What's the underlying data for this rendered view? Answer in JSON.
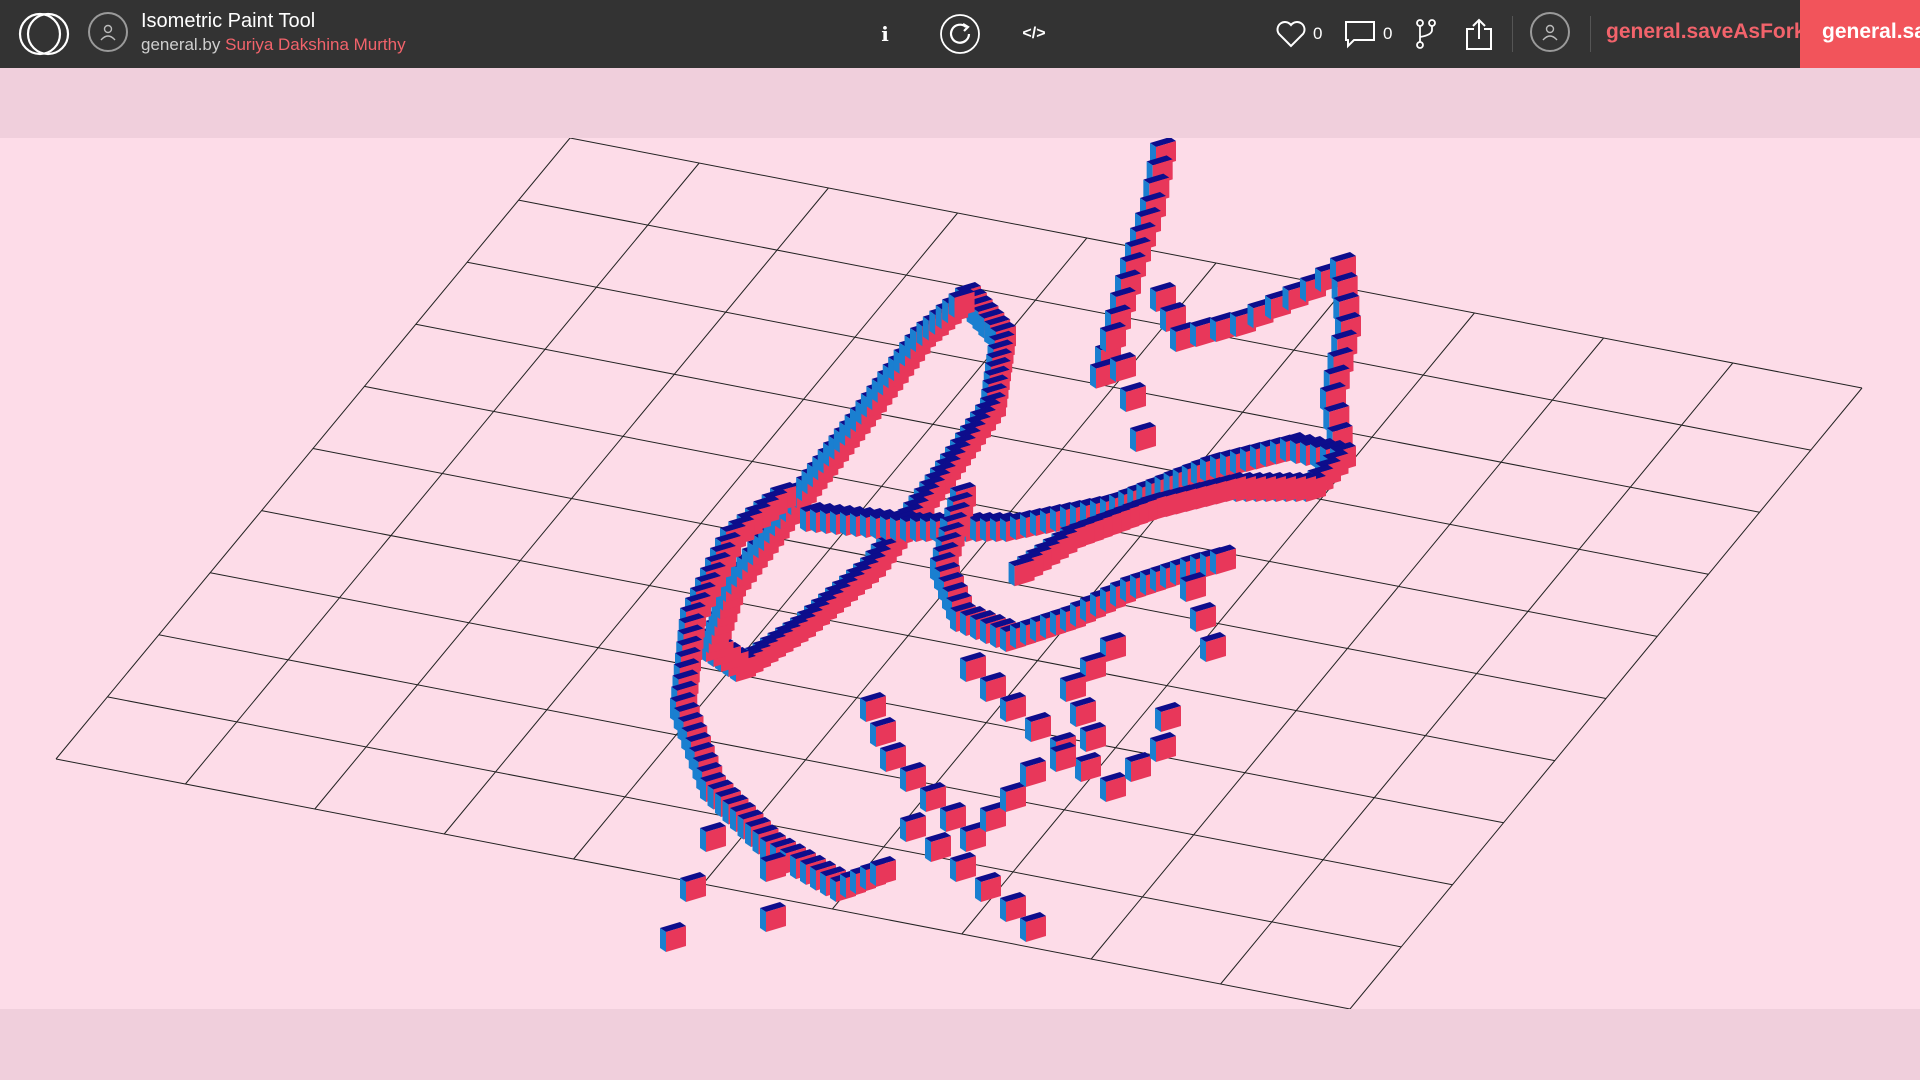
{
  "header": {
    "title": "Isometric Paint Tool",
    "by_prefix": "general.by",
    "author": "Suriya Dakshina Murthy",
    "info_label": "i",
    "code_label": "</>",
    "likes_count": "0",
    "comments_count": "0",
    "save_as_fork_label": "general.saveAsFork",
    "save_label": "general.save"
  },
  "icons": {
    "logo": "openprocessing-logo",
    "author_avatar": "user-avatar-icon",
    "info": "info-icon",
    "replay": "replay-icon",
    "code": "code-icon",
    "like": "heart-icon",
    "comment": "comment-icon",
    "fork": "fork-icon",
    "share": "share-icon",
    "user": "user-avatar-icon"
  },
  "colors": {
    "topbar": "#333333",
    "accent": "#f2545b",
    "canvas_bg": "#fddce8",
    "page_band": "#f0cfdc",
    "cube_top": "#0d0d8c",
    "cube_left": "#1a7fd0",
    "cube_right": "#e8375a",
    "grid_line": "#222222"
  }
}
